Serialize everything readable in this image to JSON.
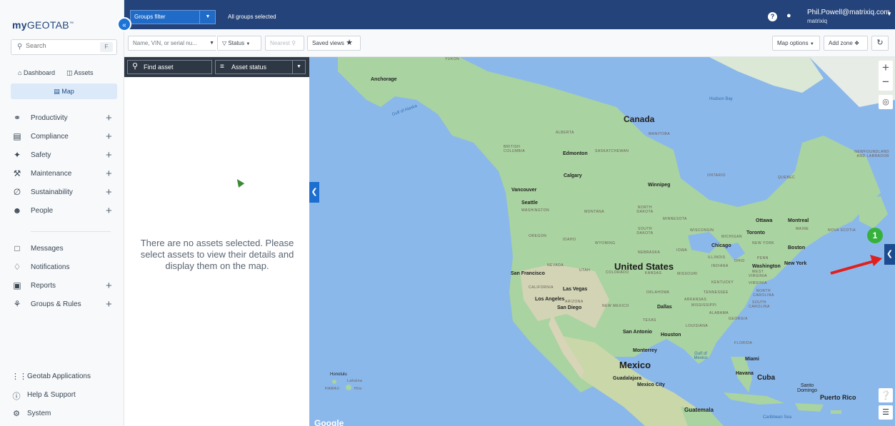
{
  "app": {
    "logo_prefix": "my",
    "logo_main": "GEOTAB",
    "logo_tm": "™",
    "collapse_icon": "«"
  },
  "search": {
    "placeholder": "Search",
    "shortcut": "F"
  },
  "sidebar": {
    "dashboard_label": "Dashboard",
    "assets_label": "Assets",
    "map_label": "Map",
    "items": [
      {
        "label": "Productivity",
        "icon": "globe-icon",
        "expandable": true
      },
      {
        "label": "Compliance",
        "icon": "clipboard-icon",
        "expandable": true
      },
      {
        "label": "Safety",
        "icon": "bandage-icon",
        "expandable": true
      },
      {
        "label": "Maintenance",
        "icon": "wrench-icon",
        "expandable": true
      },
      {
        "label": "Sustainability",
        "icon": "leaf-icon",
        "expandable": true
      },
      {
        "label": "People",
        "icon": "people-icon",
        "expandable": true
      },
      {
        "label": "Messages",
        "icon": "message-icon",
        "expandable": false
      },
      {
        "label": "Notifications",
        "icon": "bell-icon",
        "expandable": false
      },
      {
        "label": "Reports",
        "icon": "report-icon",
        "expandable": true
      },
      {
        "label": "Groups & Rules",
        "icon": "groups-icon",
        "expandable": true
      }
    ],
    "bottom": [
      {
        "label": "Geotab Applications",
        "icon": "apps-grid-icon"
      },
      {
        "label": "Help & Support",
        "icon": "help-circle-icon"
      },
      {
        "label": "System",
        "icon": "gear-icon"
      }
    ]
  },
  "header": {
    "groups_filter_label": "Groups filter",
    "groups_status": "All groups selected",
    "user_email": "Phil.Powell@matrixiq.com",
    "user_org": "matrixiq"
  },
  "toolbar": {
    "asset_search_placeholder": "Name, VIN, or serial nu...",
    "status_label": "Status",
    "nearest_label": "Nearest",
    "saved_views_label": "Saved views",
    "map_options_label": "Map options",
    "add_zone_label": "Add zone"
  },
  "asset_panel": {
    "find_asset_label": "Find asset",
    "asset_status_label": "Asset status",
    "empty_message": "There are no assets selected. Please select assets to view their details and display them on the map."
  },
  "map": {
    "attribution": "Google",
    "callout_number": "1",
    "labels": {
      "yukon": "YUKON",
      "anchorage": "Anchorage",
      "gulf_alaska": "Gulf of Alaska",
      "hudson_bay": "Hudson Bay",
      "canada": "Canada",
      "alberta": "ALBERTA",
      "manitoba": "MANITOBA",
      "british_columbia": "BRITISH COLUMBIA",
      "edmonton": "Edmonton",
      "saskatchewan": "SASKATCHEWAN",
      "newfoundland": "NEWFOUNDLAND AND LABRADOR",
      "calgary": "Calgary",
      "ontario": "ONTARIO",
      "quebec": "QUEBEC",
      "winnipeg": "Winnipeg",
      "vancouver": "Vancouver",
      "seattle": "Seattle",
      "washington": "WASHINGTON",
      "montana": "MONTANA",
      "north_dakota": "NORTH DAKOTA",
      "minnesota": "MINNESOTA",
      "ottawa": "Ottawa",
      "montreal": "Montreal",
      "oregon": "OREGON",
      "idaho": "IDAHO",
      "wyoming": "WYOMING",
      "south_dakota": "SOUTH DAKOTA",
      "wisconsin": "WISCONSIN",
      "michigan": "MICHIGAN",
      "toronto": "Toronto",
      "maine": "MAINE",
      "nova_scotia": "NOVA SCOTIA",
      "chicago": "Chicago",
      "new_york_state": "NEW YORK",
      "boston": "Boston",
      "nebraska": "NEBRASKA",
      "iowa": "IOWA",
      "nevada": "NEVADA",
      "utah": "UTAH",
      "united_states": "United States",
      "illinois": "ILLINOIS",
      "ohio": "OHIO",
      "penn": "PENN",
      "new_york_city": "New York",
      "san_francisco": "San Francisco",
      "colorado": "COLORADO",
      "kansas": "KANSAS",
      "missouri": "MISSOURI",
      "indiana": "INDIANA",
      "washington_dc": "Washington",
      "west_virginia": "WEST VIRGINIA",
      "virginia": "VIRGINIA",
      "california": "CALIFORNIA",
      "las_vegas": "Las Vegas",
      "kentucky": "KENTUCKY",
      "north_carolina": "NORTH CAROLINA",
      "los_angeles": "Los Angeles",
      "arizona": "ARIZONA",
      "oklahoma": "OKLAHOMA",
      "tennessee": "TENNESSEE",
      "arkansas": "ARKANSAS",
      "south_carolina": "SOUTH CAROLINA",
      "san_diego": "San Diego",
      "new_mexico": "NEW MEXICO",
      "dallas": "Dallas",
      "mississippi": "MISSISSIPPI",
      "alabama": "ALABAMA",
      "georgia": "GEORGIA",
      "texas": "TEXAS",
      "louisiana": "LOUISIANA",
      "san_antonio": "San Antonio",
      "houston": "Houston",
      "florida": "FLORIDA",
      "monterrey": "Monterrey",
      "gulf_mexico": "Gulf of Mexico",
      "miami": "Miami",
      "mexico": "Mexico",
      "havana": "Havana",
      "cuba": "Cuba",
      "honolulu": "Honolulu",
      "lahaina": "Lahaina",
      "hawaii": "HAWAII",
      "hilo": "Hilo",
      "guadalajara": "Guadalajara",
      "mexico_city": "Mexico City",
      "santo_domingo": "Santo Domingo",
      "puerto_rico": "Puerto Rico",
      "guatemala": "Guatemala",
      "caribbean_sea": "Caribbean Sea"
    }
  },
  "colors": {
    "header_bg": "#24437a",
    "accent": "#1c6fd1",
    "map_water": "#8bb8ea",
    "map_land": "#a9d3a0",
    "callout": "#36b23c",
    "arrow": "#e0201e"
  }
}
